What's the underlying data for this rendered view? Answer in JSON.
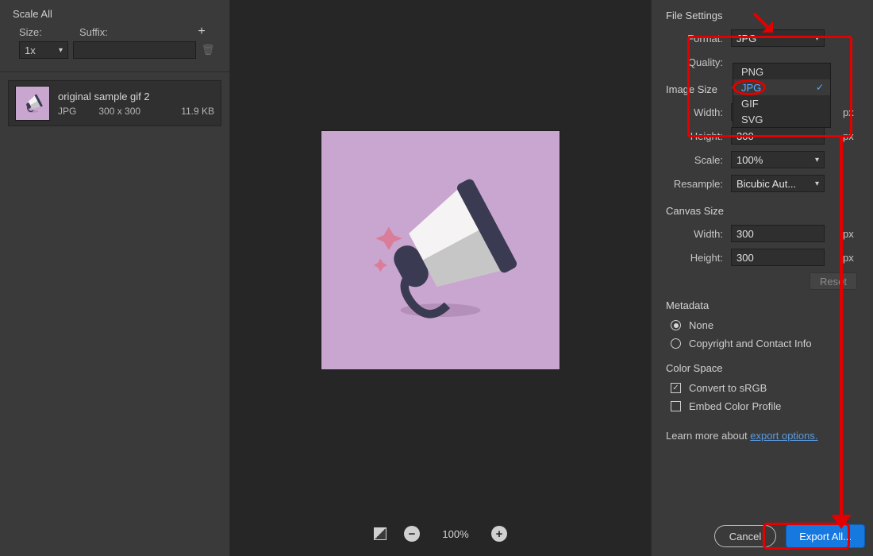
{
  "left": {
    "panel_title": "Scale All",
    "size_label": "Size:",
    "suffix_label": "Suffix:",
    "size_value": "1x",
    "add_glyph": "+",
    "asset": {
      "name": "original sample gif 2",
      "format": "JPG",
      "dimensions": "300 x 300",
      "filesize": "11.9 KB"
    }
  },
  "center": {
    "zoom_pct": "100%"
  },
  "right": {
    "file_settings_title": "File Settings",
    "format_label": "Format:",
    "format_value": "JPG",
    "quality_label": "Quality:",
    "image_size_title": "Image Size",
    "width_label": "Width:",
    "width_value": "300",
    "height_label": "Height:",
    "height_value": "300",
    "scale_label": "Scale:",
    "scale_value": "100%",
    "resample_label": "Resample:",
    "resample_value": "Bicubic Aut...",
    "canvas_title": "Canvas Size",
    "canvas_w": "300",
    "canvas_h": "300",
    "reset": "Reset",
    "unit_px": "px",
    "metadata_title": "Metadata",
    "meta_none": "None",
    "meta_copy": "Copyright and Contact Info",
    "cs_title": "Color Space",
    "cs_srgb": "Convert to sRGB",
    "cs_embed": "Embed Color Profile",
    "learn_prefix": "Learn more about  ",
    "learn_link": "export options.",
    "cancel": "Cancel",
    "export": "Export All...",
    "format_options": {
      "png": "PNG",
      "jpg": "JPG",
      "gif": "GIF",
      "svg": "SVG"
    }
  }
}
